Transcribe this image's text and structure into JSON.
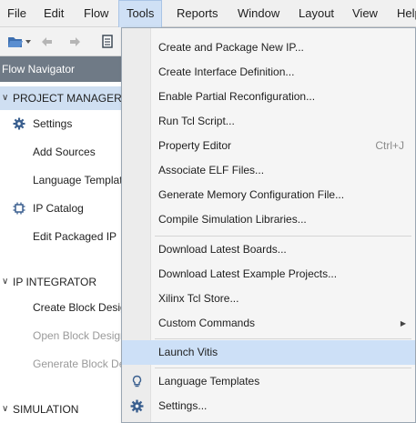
{
  "menubar": {
    "items": [
      "File",
      "Edit",
      "Flow",
      "Tools",
      "Reports",
      "Window",
      "Layout",
      "View",
      "Help"
    ],
    "active": "Tools"
  },
  "toolbar": {
    "icons": [
      "open-project-icon",
      "undo-icon",
      "redo-icon",
      "documents-icon"
    ]
  },
  "flow_navigator": {
    "title": "Flow Navigator",
    "sections": [
      {
        "label": "PROJECT MANAGER",
        "expanded": true,
        "items": [
          {
            "label": "Settings",
            "icon": "gear-icon",
            "enabled": true
          },
          {
            "label": "Add Sources",
            "enabled": true
          },
          {
            "label": "Language Templates",
            "enabled": true
          },
          {
            "label": "IP Catalog",
            "icon": "ip-catalog-icon",
            "enabled": true
          },
          {
            "label": "Edit Packaged IP",
            "enabled": true
          }
        ]
      },
      {
        "label": "IP INTEGRATOR",
        "expanded": true,
        "items": [
          {
            "label": "Create Block Design",
            "enabled": true
          },
          {
            "label": "Open Block Design",
            "enabled": false
          },
          {
            "label": "Generate Block Design",
            "enabled": false
          }
        ]
      },
      {
        "label": "SIMULATION",
        "expanded": true,
        "items": []
      }
    ]
  },
  "tools_menu": {
    "items": [
      {
        "label": "Create and Package New IP...",
        "shortcut": ""
      },
      {
        "label": "Create Interface Definition...",
        "shortcut": ""
      },
      {
        "label": "Enable Partial Reconfiguration...",
        "shortcut": ""
      },
      {
        "label": "Run Tcl Script...",
        "shortcut": ""
      },
      {
        "label": "Property Editor",
        "shortcut": "Ctrl+J"
      },
      {
        "label": "Associate ELF Files...",
        "shortcut": ""
      },
      {
        "label": "Generate Memory Configuration File...",
        "shortcut": ""
      },
      {
        "label": "Compile Simulation Libraries...",
        "shortcut": ""
      },
      {
        "label": "Download Latest Boards...",
        "shortcut": ""
      },
      {
        "label": "Download Latest Example Projects...",
        "shortcut": ""
      },
      {
        "label": "Xilinx Tcl Store...",
        "shortcut": ""
      },
      {
        "label": "Custom Commands",
        "submenu": true
      },
      {
        "label": "Launch Vitis",
        "selected": true
      },
      {
        "label": "Language Templates",
        "icon": "lightbulb-icon"
      },
      {
        "label": "Settings...",
        "icon": "gear-icon"
      }
    ]
  },
  "colors": {
    "menu_highlight": "#cde0f7",
    "navigator_header": "#6f7a86",
    "section_highlight": "#cfdff2"
  }
}
